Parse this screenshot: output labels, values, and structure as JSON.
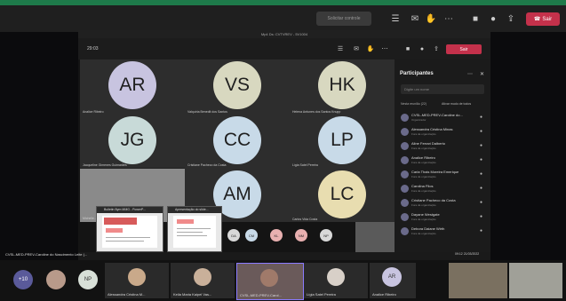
{
  "outer_toolbar": {
    "dim_button": "Solicitar controle",
    "leave_label": "Sair"
  },
  "inner_window": {
    "title": "Mp4 Ds: CVTVREV - 5V1004",
    "time": "29:03",
    "leave_label": "Sair"
  },
  "tiles": [
    {
      "initials": "AR",
      "name": "Analice Ribeiro",
      "color": "#c8c4e0"
    },
    {
      "initials": "VS",
      "name": "Valquíria Benedit dos Santos",
      "color": "#d8d8c0"
    },
    {
      "initials": "HK",
      "name": "Helena Antunes dos Santos Knupp",
      "color": "#d8d8c0"
    },
    {
      "initials": "JG",
      "name": "Jacqueline Gimenes Guimarães",
      "color": "#c8dad8"
    },
    {
      "initials": "CC",
      "name": "Cristiane Pacheco da Costa",
      "color": "#c8dae8"
    },
    {
      "initials": "LP",
      "name": "Lígia Satel Pereira",
      "color": "#c8dae8"
    },
    {
      "initials": "AM",
      "name": "",
      "color": "#c8dae8"
    },
    {
      "initials": "LC",
      "name": "Carlos Vida Costa",
      "color": "#e8ddb0"
    }
  ],
  "selfview_name": "Michelle...",
  "popups": [
    {
      "title": "Bulletin Bym MMG - PowerP..."
    },
    {
      "title": "Apresentação do slide..."
    }
  ],
  "small_avatars": [
    "DA",
    "CM",
    "KL",
    "NM",
    "NP"
  ],
  "panel": {
    "title": "Participantes",
    "search_placeholder": "Digite um nome",
    "section": "Nesta reunião (22)",
    "mute_all": "Ativar mudo de todos",
    "people": [
      {
        "name": "CVSL-MED-PREV-Caroline do...",
        "sub": "Organizador"
      },
      {
        "name": "Alessandra Cristina Minas",
        "sub": "Fora da organização"
      },
      {
        "name": "Aline Ferrari Dalberto",
        "sub": "Fora da organização"
      },
      {
        "name": "Analice Ribeiro",
        "sub": "Fora da organização"
      },
      {
        "name": "Carla Thais Moreira Emerique",
        "sub": "Fora da organização"
      },
      {
        "name": "Carolina Filos",
        "sub": "Fora da organização"
      },
      {
        "name": "Cristiane Pacheco da Costa",
        "sub": "Fora da organização"
      },
      {
        "name": "Dayane Westgate",
        "sub": "Fora da organização"
      },
      {
        "name": "Debora Daiane Wirth",
        "sub": "Fora da organização"
      }
    ]
  },
  "status_line": "CVSL-MED-PREV-Caroline do Nascimento Leite (...",
  "taskbar_time": "09:12 21/03/2022",
  "bottom": [
    {
      "label": "+10",
      "name": ""
    },
    {
      "label": "",
      "name": ""
    },
    {
      "label": "NP",
      "name": ""
    },
    {
      "label": "",
      "name": "Alessandra Cristina M..."
    },
    {
      "label": "",
      "name": "Keila Maria Kaipel Vas..."
    },
    {
      "label": "",
      "name": "CVSL-MED-PREV-Carol..."
    },
    {
      "label": "",
      "name": "Lígia Satel Pereira"
    },
    {
      "label": "AR",
      "name": "Analice Ribeiro"
    },
    {
      "label": "",
      "name": ""
    }
  ]
}
